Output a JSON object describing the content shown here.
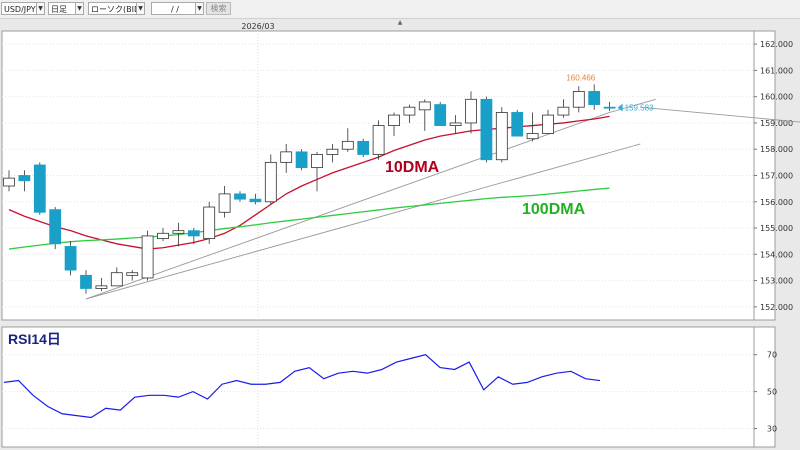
{
  "toolbar": {
    "symbol": "USD/JPY",
    "timeframe": "日足",
    "chart_type": "ローソク(BID)",
    "date": "/  /",
    "search_label": "検索"
  },
  "colors": {
    "up_candle_fill": "#ffffff",
    "down_candle_fill": "#1aa0c8",
    "candle_outline": "#333333",
    "dma10": "#c8102e",
    "dma100": "#2ecc40",
    "rsi": "#1a1aee",
    "trendline": "#9a9a9a",
    "label_10dma": "#b0001e",
    "label_100dma": "#22b022",
    "label_rsi": "#1a237e",
    "high_label": "#f08030",
    "price_label": "#30b0d8"
  },
  "chart_data": [
    {
      "type": "candlestick",
      "title": "",
      "date_label": "2026/03",
      "ylim": [
        151.5,
        162.5
      ],
      "yticks": [
        "162.000",
        "161.000",
        "160.000",
        "159.000",
        "158.000",
        "157.000",
        "156.000",
        "155.000",
        "154.000",
        "153.000",
        "152.000"
      ],
      "grid": true,
      "candles": [
        {
          "o": 156.6,
          "h": 157.2,
          "l": 156.4,
          "c": 156.9
        },
        {
          "o": 157.0,
          "h": 157.2,
          "l": 156.4,
          "c": 156.8
        },
        {
          "o": 157.4,
          "h": 157.5,
          "l": 155.5,
          "c": 155.6
        },
        {
          "o": 155.7,
          "h": 155.8,
          "l": 154.2,
          "c": 154.4
        },
        {
          "o": 154.3,
          "h": 154.5,
          "l": 153.2,
          "c": 153.4
        },
        {
          "o": 153.2,
          "h": 153.4,
          "l": 152.5,
          "c": 152.7
        },
        {
          "o": 152.7,
          "h": 153.1,
          "l": 152.6,
          "c": 152.8
        },
        {
          "o": 152.8,
          "h": 153.5,
          "l": 152.8,
          "c": 153.3
        },
        {
          "o": 153.2,
          "h": 153.4,
          "l": 153.0,
          "c": 153.3
        },
        {
          "o": 153.1,
          "h": 154.9,
          "l": 153.0,
          "c": 154.7
        },
        {
          "o": 154.6,
          "h": 155.0,
          "l": 154.5,
          "c": 154.8
        },
        {
          "o": 154.8,
          "h": 155.2,
          "l": 154.3,
          "c": 154.9
        },
        {
          "o": 154.9,
          "h": 155.0,
          "l": 154.4,
          "c": 154.7
        },
        {
          "o": 154.6,
          "h": 156.0,
          "l": 154.4,
          "c": 155.8
        },
        {
          "o": 155.6,
          "h": 156.6,
          "l": 155.4,
          "c": 156.3
        },
        {
          "o": 156.3,
          "h": 156.4,
          "l": 156.0,
          "c": 156.1
        },
        {
          "o": 156.1,
          "h": 156.3,
          "l": 155.9,
          "c": 156.0
        },
        {
          "o": 156.0,
          "h": 157.8,
          "l": 155.9,
          "c": 157.5
        },
        {
          "o": 157.5,
          "h": 158.2,
          "l": 157.1,
          "c": 157.9
        },
        {
          "o": 157.9,
          "h": 158.0,
          "l": 157.2,
          "c": 157.3
        },
        {
          "o": 157.3,
          "h": 157.9,
          "l": 156.4,
          "c": 157.8
        },
        {
          "o": 157.8,
          "h": 158.2,
          "l": 157.5,
          "c": 158.0
        },
        {
          "o": 158.0,
          "h": 158.8,
          "l": 157.9,
          "c": 158.3
        },
        {
          "o": 158.3,
          "h": 158.4,
          "l": 157.7,
          "c": 157.8
        },
        {
          "o": 157.8,
          "h": 159.1,
          "l": 157.6,
          "c": 158.9
        },
        {
          "o": 158.9,
          "h": 159.4,
          "l": 158.5,
          "c": 159.3
        },
        {
          "o": 159.3,
          "h": 159.7,
          "l": 159.0,
          "c": 159.6
        },
        {
          "o": 159.5,
          "h": 159.9,
          "l": 158.7,
          "c": 159.8
        },
        {
          "o": 159.7,
          "h": 159.8,
          "l": 158.9,
          "c": 158.9
        },
        {
          "o": 158.9,
          "h": 159.3,
          "l": 158.6,
          "c": 159.0
        },
        {
          "o": 159.0,
          "h": 160.2,
          "l": 158.6,
          "c": 159.9
        },
        {
          "o": 159.9,
          "h": 160.0,
          "l": 157.5,
          "c": 157.6
        },
        {
          "o": 157.6,
          "h": 159.6,
          "l": 157.5,
          "c": 159.4
        },
        {
          "o": 159.4,
          "h": 159.5,
          "l": 158.6,
          "c": 158.5
        },
        {
          "o": 158.4,
          "h": 159.4,
          "l": 158.3,
          "c": 158.6
        },
        {
          "o": 158.6,
          "h": 159.5,
          "l": 158.6,
          "c": 159.3
        },
        {
          "o": 159.3,
          "h": 159.9,
          "l": 159.2,
          "c": 159.6
        },
        {
          "o": 159.6,
          "h": 160.4,
          "l": 159.4,
          "c": 160.2
        },
        {
          "o": 160.2,
          "h": 160.47,
          "l": 159.5,
          "c": 159.7
        },
        {
          "o": 159.6,
          "h": 159.8,
          "l": 159.45,
          "c": 159.58
        }
      ],
      "series": [
        {
          "name": "10DMA",
          "values": [
            155.7,
            155.45,
            155.25,
            155.05,
            154.9,
            154.7,
            154.55,
            154.4,
            154.3,
            154.2,
            154.25,
            154.35,
            154.45,
            154.6,
            154.8,
            155.1,
            155.5,
            155.9,
            156.3,
            156.6,
            156.85,
            157.1,
            157.3,
            157.5,
            157.7,
            157.95,
            158.15,
            158.35,
            158.5,
            158.6,
            158.7,
            158.75,
            158.8,
            158.85,
            158.9,
            158.95,
            159.0,
            159.08,
            159.15,
            159.25
          ]
        },
        {
          "name": "100DMA",
          "values": [
            154.2,
            154.28,
            154.35,
            154.42,
            154.48,
            154.52,
            154.55,
            154.58,
            154.62,
            154.66,
            154.7,
            154.75,
            154.82,
            154.9,
            154.98,
            155.05,
            155.12,
            155.2,
            155.27,
            155.34,
            155.41,
            155.48,
            155.55,
            155.62,
            155.69,
            155.76,
            155.82,
            155.88,
            155.94,
            156.0,
            156.06,
            156.12,
            156.17,
            156.2,
            156.24,
            156.29,
            156.35,
            156.41,
            156.47,
            156.52
          ]
        }
      ],
      "trendlines": [
        {
          "x1": 5,
          "y1": 152.3,
          "x2": 39,
          "y2": 159.4
        },
        {
          "x1": 39,
          "y1": 159.4,
          "x2": 42,
          "y2": 159.9
        }
      ],
      "secondary_trendlines": [
        {
          "x1": 5,
          "y1": 152.3,
          "x2": 41,
          "y2": 159.6
        },
        {
          "x1": 41,
          "y1": 159.6,
          "x2": 52,
          "y2": 160.4
        }
      ],
      "annotations": {
        "high": "160.466",
        "last": "159.583",
        "label_10dma": "10DMA",
        "label_100dma": "100DMA"
      }
    },
    {
      "type": "line",
      "title": "RSI14日",
      "ylim": [
        20,
        85
      ],
      "yticks": [
        "70",
        "50",
        "30"
      ],
      "series": [
        {
          "name": "RSI14日",
          "values": [
            55,
            56,
            48,
            42,
            38,
            37,
            36,
            41,
            40,
            47,
            48,
            48,
            47,
            50,
            46,
            54,
            56,
            54,
            54,
            55,
            61,
            63,
            57,
            60,
            61,
            60,
            62,
            66,
            68,
            70,
            63,
            62,
            66,
            51,
            58,
            54,
            55,
            58,
            60,
            61,
            57,
            56
          ]
        }
      ]
    }
  ]
}
